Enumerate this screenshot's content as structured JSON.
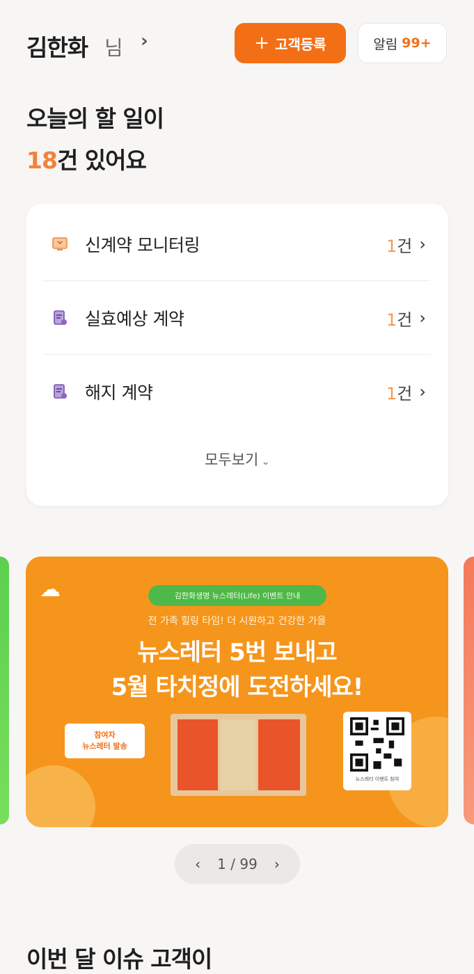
{
  "header": {
    "user_name": "김한화",
    "user_suffix": "님",
    "add_customer_label": "고객등록",
    "notice_label": "알림",
    "notice_count": "99+"
  },
  "todo": {
    "line1": "오늘의 할 일이",
    "count": "18",
    "line2_rest": "건 있어요",
    "items": [
      {
        "label": "신계약 모니터링",
        "count": "1",
        "unit": "건",
        "icon": "monitor-icon"
      },
      {
        "label": "실효예상 계약",
        "count": "1",
        "unit": "건",
        "icon": "document-icon"
      },
      {
        "label": "해지 계약",
        "count": "1",
        "unit": "건",
        "icon": "document-icon"
      }
    ],
    "see_all_label": "모두보기"
  },
  "banner": {
    "pill": "김한화생명 뉴스레터(Life) 이벤트 안내",
    "subtitle": "전 가족 힐링 타임! 더 시원하고 건강한 가을",
    "headline1": "뉴스레터 5번 보내고",
    "headline2": "5월 타치정에 도전하세요!",
    "tag_line1": "참여자",
    "tag_line2": "뉴스레터 발송",
    "qr_caption": "뉴스레터 이벤트 참여",
    "colors": {
      "background": "#f6951b",
      "pill": "#4fb84a"
    }
  },
  "pager": {
    "current": "1",
    "total": "99"
  },
  "section_title": "이번 달 이슈 고객이",
  "colors": {
    "accent": "#f36f16",
    "background": "#f7f6f4"
  }
}
